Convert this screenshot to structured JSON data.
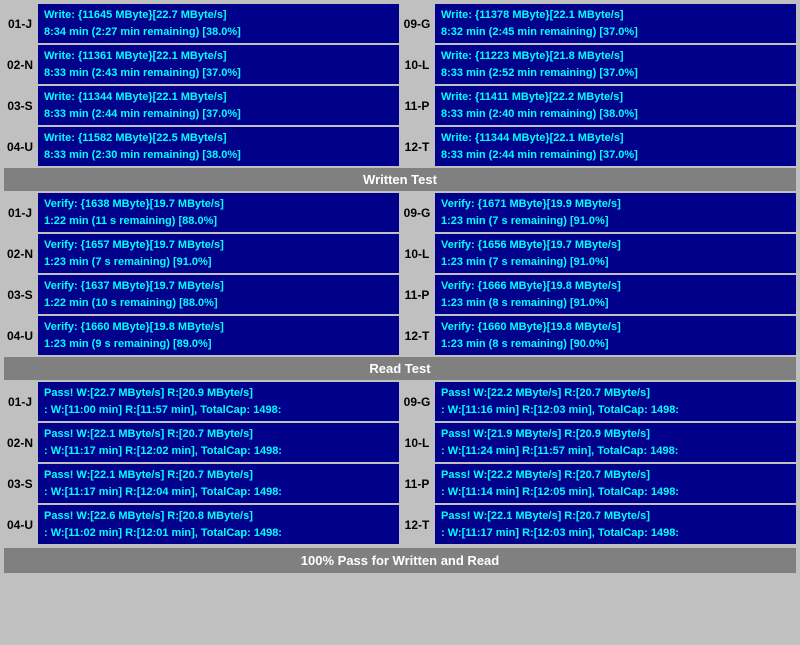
{
  "sections": {
    "write": {
      "label": "Written Test",
      "rows": [
        {
          "left_id": "01-J",
          "left_line1": "Write: {11645 MByte}[22.7 MByte/s]",
          "left_line2": "8:34 min (2:27 min remaining)  [38.0%]",
          "right_id": "09-G",
          "right_line1": "Write: {11378 MByte}[22.1 MByte/s]",
          "right_line2": "8:32 min (2:45 min remaining)  [37.0%]"
        },
        {
          "left_id": "02-N",
          "left_line1": "Write: {11361 MByte}[22.1 MByte/s]",
          "left_line2": "8:33 min (2:43 min remaining)  [37.0%]",
          "right_id": "10-L",
          "right_line1": "Write: {11223 MByte}[21.8 MByte/s]",
          "right_line2": "8:33 min (2:52 min remaining)  [37.0%]"
        },
        {
          "left_id": "03-S",
          "left_line1": "Write: {11344 MByte}[22.1 MByte/s]",
          "left_line2": "8:33 min (2:44 min remaining)  [37.0%]",
          "right_id": "11-P",
          "right_line1": "Write: {11411 MByte}[22.2 MByte/s]",
          "right_line2": "8:33 min (2:40 min remaining)  [38.0%]"
        },
        {
          "left_id": "04-U",
          "left_line1": "Write: {11582 MByte}[22.5 MByte/s]",
          "left_line2": "8:33 min (2:30 min remaining)  [38.0%]",
          "right_id": "12-T",
          "right_line1": "Write: {11344 MByte}[22.1 MByte/s]",
          "right_line2": "8:33 min (2:44 min remaining)  [37.0%]"
        }
      ]
    },
    "verify": {
      "label": "Written Test",
      "rows": [
        {
          "left_id": "01-J",
          "left_line1": "Verify: {1638 MByte}[19.7 MByte/s]",
          "left_line2": "1:22 min (11 s remaining)  [88.0%]",
          "right_id": "09-G",
          "right_line1": "Verify: {1671 MByte}[19.9 MByte/s]",
          "right_line2": "1:23 min (7 s remaining)  [91.0%]"
        },
        {
          "left_id": "02-N",
          "left_line1": "Verify: {1657 MByte}[19.7 MByte/s]",
          "left_line2": "1:23 min (7 s remaining)  [91.0%]",
          "right_id": "10-L",
          "right_line1": "Verify: {1656 MByte}[19.7 MByte/s]",
          "right_line2": "1:23 min (7 s remaining)  [91.0%]"
        },
        {
          "left_id": "03-S",
          "left_line1": "Verify: {1637 MByte}[19.7 MByte/s]",
          "left_line2": "1:22 min (10 s remaining)  [88.0%]",
          "right_id": "11-P",
          "right_line1": "Verify: {1666 MByte}[19.8 MByte/s]",
          "right_line2": "1:23 min (8 s remaining)  [91.0%]"
        },
        {
          "left_id": "04-U",
          "left_line1": "Verify: {1660 MByte}[19.8 MByte/s]",
          "left_line2": "1:23 min (9 s remaining)  [89.0%]",
          "right_id": "12-T",
          "right_line1": "Verify: {1660 MByte}[19.8 MByte/s]",
          "right_line2": "1:23 min (8 s remaining)  [90.0%]"
        }
      ]
    },
    "read": {
      "label": "Read Test",
      "rows": [
        {
          "left_id": "01-J",
          "left_line1": "Pass! W:[22.7 MByte/s] R:[20.9 MByte/s]",
          "left_line2": ": W:[11:00 min] R:[11:57 min], TotalCap: 1498:",
          "right_id": "09-G",
          "right_line1": "Pass! W:[22.2 MByte/s] R:[20.7 MByte/s]",
          "right_line2": ": W:[11:16 min] R:[12:03 min], TotalCap: 1498:"
        },
        {
          "left_id": "02-N",
          "left_line1": "Pass! W:[22.1 MByte/s] R:[20.7 MByte/s]",
          "left_line2": ": W:[11:17 min] R:[12:02 min], TotalCap: 1498:",
          "right_id": "10-L",
          "right_line1": "Pass! W:[21.9 MByte/s] R:[20.9 MByte/s]",
          "right_line2": ": W:[11:24 min] R:[11:57 min], TotalCap: 1498:"
        },
        {
          "left_id": "03-S",
          "left_line1": "Pass! W:[22.1 MByte/s] R:[20.7 MByte/s]",
          "left_line2": ": W:[11:17 min] R:[12:04 min], TotalCap: 1498:",
          "right_id": "11-P",
          "right_line1": "Pass! W:[22.2 MByte/s] R:[20.7 MByte/s]",
          "right_line2": ": W:[11:14 min] R:[12:05 min], TotalCap: 1498:"
        },
        {
          "left_id": "04-U",
          "left_line1": "Pass! W:[22.6 MByte/s] R:[20.8 MByte/s]",
          "left_line2": ": W:[11:02 min] R:[12:01 min], TotalCap: 1498:",
          "right_id": "12-T",
          "right_line1": "Pass! W:[22.1 MByte/s] R:[20.7 MByte/s]",
          "right_line2": ": W:[11:17 min] R:[12:03 min], TotalCap: 1498:"
        }
      ]
    }
  },
  "labels": {
    "written_test": "Written Test",
    "read_test": "Read Test",
    "pass_summary": "100% Pass for Written and Read"
  }
}
